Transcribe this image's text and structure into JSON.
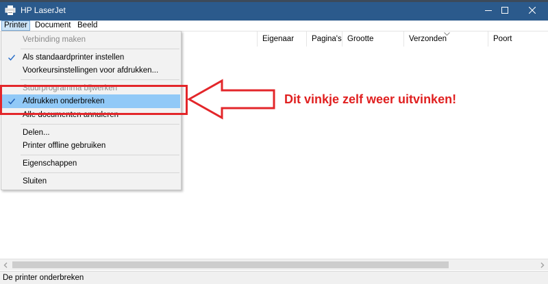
{
  "window": {
    "title": "HP LaserJet",
    "icons": {
      "app": "printer-icon",
      "minimize": "minimize-icon",
      "maximize": "maximize-icon",
      "close": "close-icon"
    }
  },
  "menubar": {
    "items": [
      {
        "label": "Printer"
      },
      {
        "label": "Document"
      },
      {
        "label": "Beeld"
      }
    ]
  },
  "list": {
    "columns": [
      {
        "label": "Eigenaar"
      },
      {
        "label": "Pagina's"
      },
      {
        "label": "Grootte"
      },
      {
        "label": "Verzonden"
      },
      {
        "label": "Poort"
      }
    ],
    "sorted_column": "Verzonden"
  },
  "printer_menu": {
    "items": [
      {
        "label": "Verbinding maken",
        "disabled": true,
        "checked": false
      },
      {
        "label": "Als standaardprinter instellen",
        "disabled": false,
        "checked": true
      },
      {
        "label": "Voorkeursinstellingen voor afdrukken...",
        "disabled": false,
        "checked": false
      },
      {
        "label": "Stuurprogramma bijwerken",
        "disabled": true,
        "checked": false
      },
      {
        "label": "Afdrukken onderbreken",
        "disabled": false,
        "checked": true,
        "highlighted": true
      },
      {
        "label": "Alle documenten annuleren",
        "disabled": false,
        "checked": false
      },
      {
        "label": "Delen...",
        "disabled": false,
        "checked": false
      },
      {
        "label": "Printer offline gebruiken",
        "disabled": false,
        "checked": false
      },
      {
        "label": "Eigenschappen",
        "disabled": false,
        "checked": false
      },
      {
        "label": "Sluiten",
        "disabled": false,
        "checked": false
      }
    ]
  },
  "annotation": {
    "text": "Dit vinkje zelf weer uitvinken!",
    "color": "#e02020"
  },
  "status": {
    "text": "De printer onderbreken"
  },
  "colors": {
    "titlebar": "#2b5a8c",
    "highlight": "#91c9f7",
    "accent_red": "#e3262a"
  }
}
